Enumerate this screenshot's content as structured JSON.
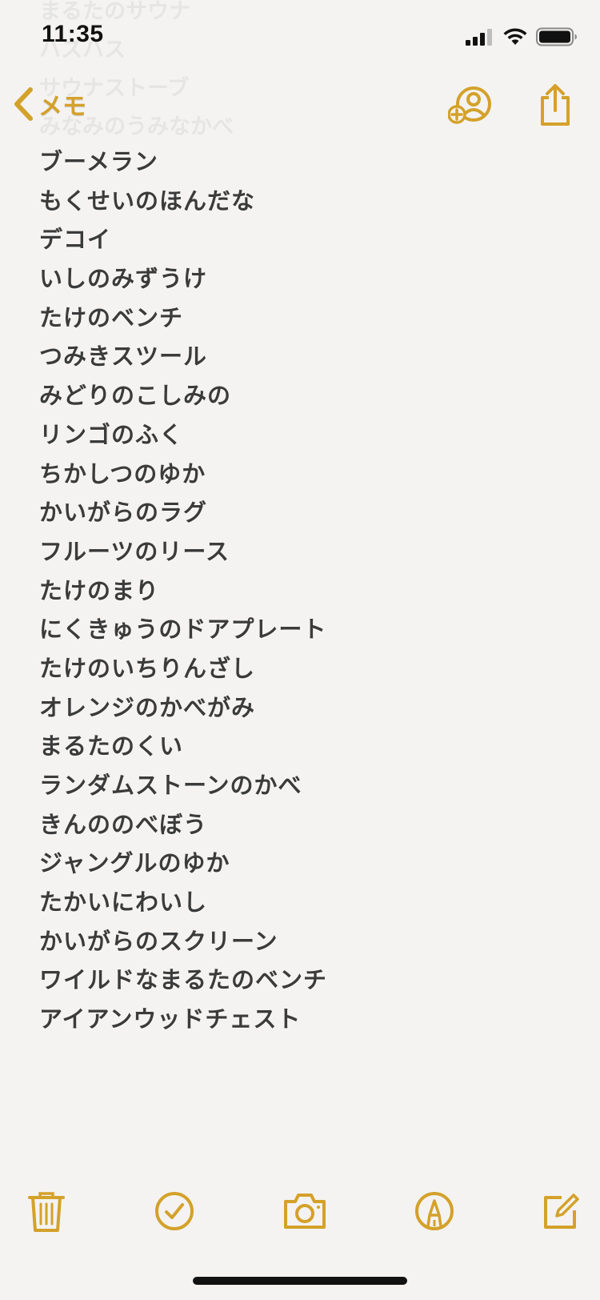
{
  "status_bar": {
    "time": "11:35",
    "signal_icon": "cellular-signal-icon",
    "wifi_icon": "wifi-icon",
    "battery_icon": "battery-icon"
  },
  "nav": {
    "back_label": "メモ",
    "back_icon": "chevron-left-icon",
    "add_person_icon": "add-person-icon",
    "share_icon": "share-icon"
  },
  "accent_color": "#d4a12a",
  "ghost_lines": [
    "まるたのサウナ",
    "ハスハス",
    "サウナストーブ",
    "みなみのうみなかべ"
  ],
  "note_lines": [
    "ブーメラン",
    "もくせいのほんだな",
    "デコイ",
    "いしのみずうけ",
    "たけのベンチ",
    "つみきスツール",
    "みどりのこしみの",
    "リンゴのふく",
    "ちかしつのゆか",
    "かいがらのラグ",
    "フルーツのリース",
    "たけのまり",
    "にくきゅうのドアプレート",
    "たけのいちりんざし",
    "オレンジのかべがみ",
    "まるたのくい",
    "ランダムストーンのかべ",
    "きんののべぼう",
    "ジャングルのゆか",
    "たかいにわいし",
    "かいがらのスクリーン",
    "ワイルドなまるたのベンチ",
    "アイアンウッドチェスト"
  ],
  "toolbar": {
    "delete_icon": "trash-icon",
    "checklist_icon": "checkmark-circle-icon",
    "camera_icon": "camera-icon",
    "markup_icon": "markup-pen-icon",
    "compose_icon": "compose-icon"
  }
}
